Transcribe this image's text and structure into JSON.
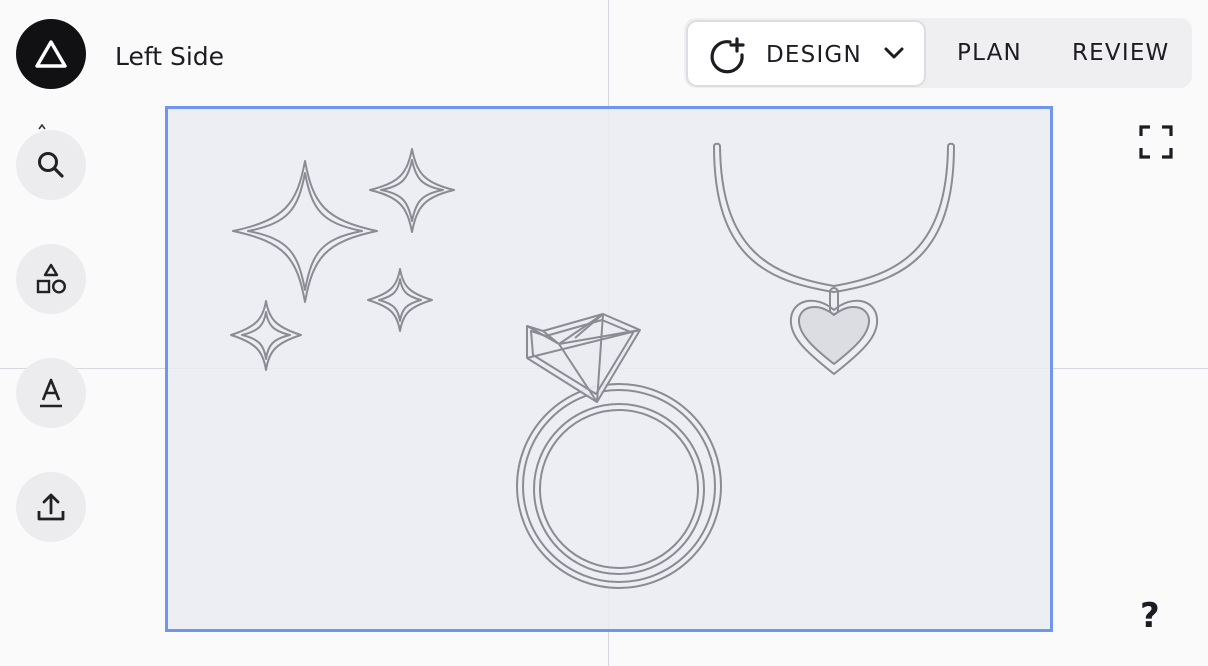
{
  "app": {
    "logo_icon": "triangle-logo-icon",
    "title": "Left Side"
  },
  "toolbar": {
    "tools": [
      {
        "name": "search",
        "icon": "search-icon"
      },
      {
        "name": "shapes",
        "icon": "shapes-icon"
      },
      {
        "name": "text",
        "icon": "text-icon"
      },
      {
        "name": "upload",
        "icon": "upload-icon"
      }
    ]
  },
  "modes": {
    "design_label": "DESIGN",
    "plan_label": "PLAN",
    "review_label": "REVIEW",
    "active": "DESIGN"
  },
  "canvas": {
    "selection_color": "#6e96ee",
    "artwork": [
      "sparkles",
      "diamond-ring",
      "heart-necklace"
    ]
  },
  "help_label": "?"
}
